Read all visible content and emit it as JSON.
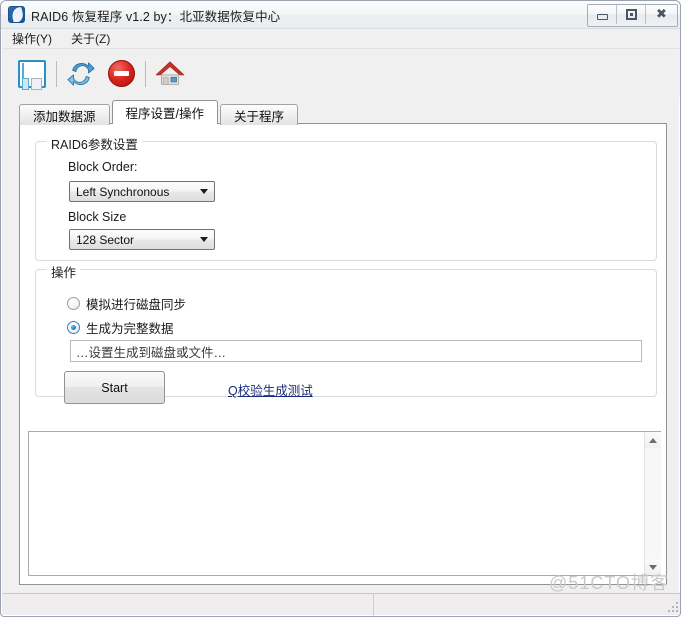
{
  "window": {
    "title": "RAID6 恢复程序 v1.2 by：北亚数据恢复中心",
    "app_icon": "app-icon",
    "controls": {
      "minimize": "–",
      "maximize": "❐",
      "close": "✕"
    }
  },
  "menubar": {
    "items": [
      {
        "label": "操作(Y)",
        "name": "menu-operation"
      },
      {
        "label": "关于(Z)",
        "name": "menu-about"
      }
    ]
  },
  "toolbar": {
    "buttons": [
      {
        "name": "layout-panel-icon",
        "tooltip": ""
      },
      {
        "name": "refresh-icon",
        "tooltip": ""
      },
      {
        "name": "stop-icon",
        "tooltip": ""
      },
      {
        "name": "home-icon",
        "tooltip": ""
      }
    ]
  },
  "tabs": [
    {
      "label": "添加数据源",
      "active": false,
      "name": "tab-add-data-source"
    },
    {
      "label": "程序设置/操作",
      "active": true,
      "name": "tab-settings-operations"
    },
    {
      "label": "关于程序",
      "active": false,
      "name": "tab-about-program"
    }
  ],
  "raid_params": {
    "group_title": "RAID6参数设置",
    "block_order": {
      "label": "Block Order:",
      "value": "Left Synchronous"
    },
    "block_size": {
      "label": "Block Size",
      "value": "128 Sector"
    }
  },
  "operations": {
    "group_title": "操作",
    "radios": [
      {
        "label": "模拟进行磁盘同步",
        "checked": false,
        "name": "radio-simulate-disk-sync"
      },
      {
        "label": "生成为完整数据",
        "checked": true,
        "name": "radio-generate-full-data"
      }
    ],
    "output_path": {
      "value": "",
      "placeholder": "…设置生成到磁盘或文件…"
    },
    "start_button": "Start",
    "test_link": "Q校验生成测试"
  },
  "log": {
    "content": ""
  },
  "statusbar": {
    "left_text": "",
    "right_text": ""
  },
  "watermark": {
    "text": "@51CTO博客"
  },
  "colors": {
    "accent_blue": "#1f7fc4",
    "link_navy": "#1b2b7a",
    "stop_red": "#d8231c",
    "house_red": "#c8302a",
    "window_bg": "#f0f0f0",
    "panel_white": "#ffffff",
    "watermark_gray": "#c9c9c9"
  }
}
